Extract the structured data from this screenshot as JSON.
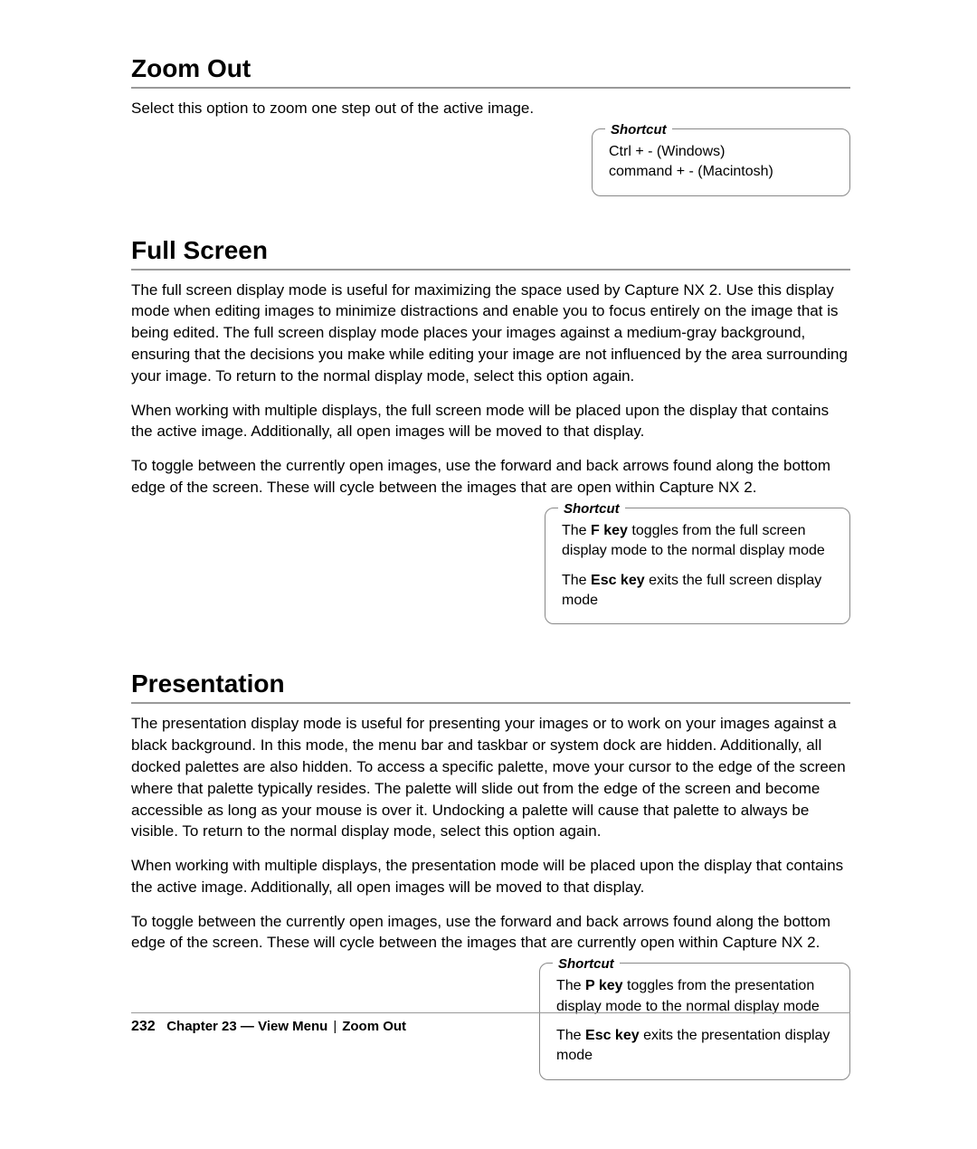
{
  "sections": {
    "zoomout": {
      "title": "Zoom Out",
      "p1": "Select this option to zoom one step out of the active image.",
      "shortcut_label": "Shortcut",
      "shortcut_line1": "Ctrl + - (Windows)",
      "shortcut_line2": "command + - (Macintosh)"
    },
    "fullscreen": {
      "title": "Full Screen",
      "p1": "The full screen display mode is useful for maximizing the space used by Capture NX 2. Use this display mode when editing images to minimize distractions and enable you to focus entirely on the image that is being edited. The full screen display mode places your images against a medium-gray background, ensuring that the decisions you make while editing your image are not influenced by the area surrounding your image. To return to the normal display mode, select this option again.",
      "p2": "When working with multiple displays, the full screen mode will be placed upon the display that contains the active image. Additionally, all open images will be moved to that display.",
      "p3": "To toggle between the currently open images, use the forward and back arrows found along the bottom edge of the screen. These will cycle between the images that are open within Capture NX 2.",
      "shortcut_label": "Shortcut",
      "sc1_a": "The ",
      "sc1_b": "F key",
      "sc1_c": " toggles from the full screen display mode to the normal display mode",
      "sc2_a": "The ",
      "sc2_b": "Esc key",
      "sc2_c": " exits the full screen display mode"
    },
    "presentation": {
      "title": "Presentation",
      "p1": "The presentation display mode is useful for presenting your images or to work on your images against a black background. In this mode, the menu bar and taskbar or system dock are hidden. Additionally, all docked palettes are also hidden. To access a specific palette, move your cursor to the edge of the screen where that palette typically resides. The palette will slide out from the edge of the screen and become accessible as long as your mouse is over it. Undocking a palette will cause that palette to always be visible. To return to the normal display mode, select this option again.",
      "p2": "When working with multiple displays, the presentation mode will be placed upon the display that contains the active image. Additionally, all open images will be moved to that display.",
      "p3": "To toggle between the currently open images, use the forward and back arrows found along the bottom edge of the screen. These will cycle between the images that are currently open within Capture NX 2.",
      "shortcut_label": "Shortcut",
      "sc1_a": "The ",
      "sc1_b": "P key",
      "sc1_c": " toggles from the presentation display mode to the normal display mode",
      "sc2_a": "The ",
      "sc2_b": "Esc key",
      "sc2_c": " exits the presentation display mode"
    }
  },
  "footer": {
    "page": "232",
    "chapter": "Chapter 23 — View Menu",
    "sep": "|",
    "topic": "Zoom Out"
  }
}
